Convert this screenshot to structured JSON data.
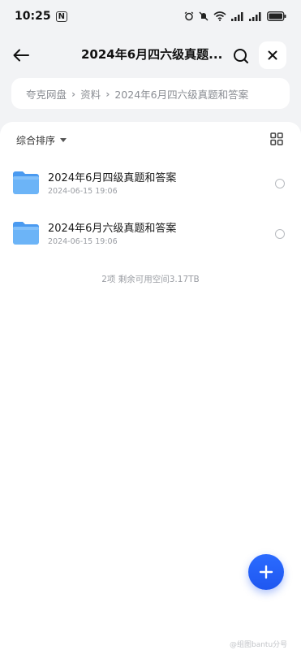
{
  "status_bar": {
    "time": "10:25",
    "nfc_label": "N"
  },
  "header": {
    "title": "2024年6月四六级真题..."
  },
  "breadcrumb": {
    "items": [
      "夸克网盘",
      "资料",
      "2024年6月四六级真题和答案"
    ]
  },
  "toolbar": {
    "sort_label": "综合排序"
  },
  "files": [
    {
      "name": "2024年6月四级真题和答案",
      "date": "2024-06-15 19:06",
      "type": "folder"
    },
    {
      "name": "2024年6月六级真题和答案",
      "date": "2024-06-15 19:06",
      "type": "folder"
    }
  ],
  "footer": {
    "summary": "2项 剩余可用空间3.17TB"
  },
  "watermark": "@组图bantu分号",
  "colors": {
    "accent": "#1f57f0",
    "folder": "#5aa8f5",
    "background": "#f2f3f5"
  }
}
